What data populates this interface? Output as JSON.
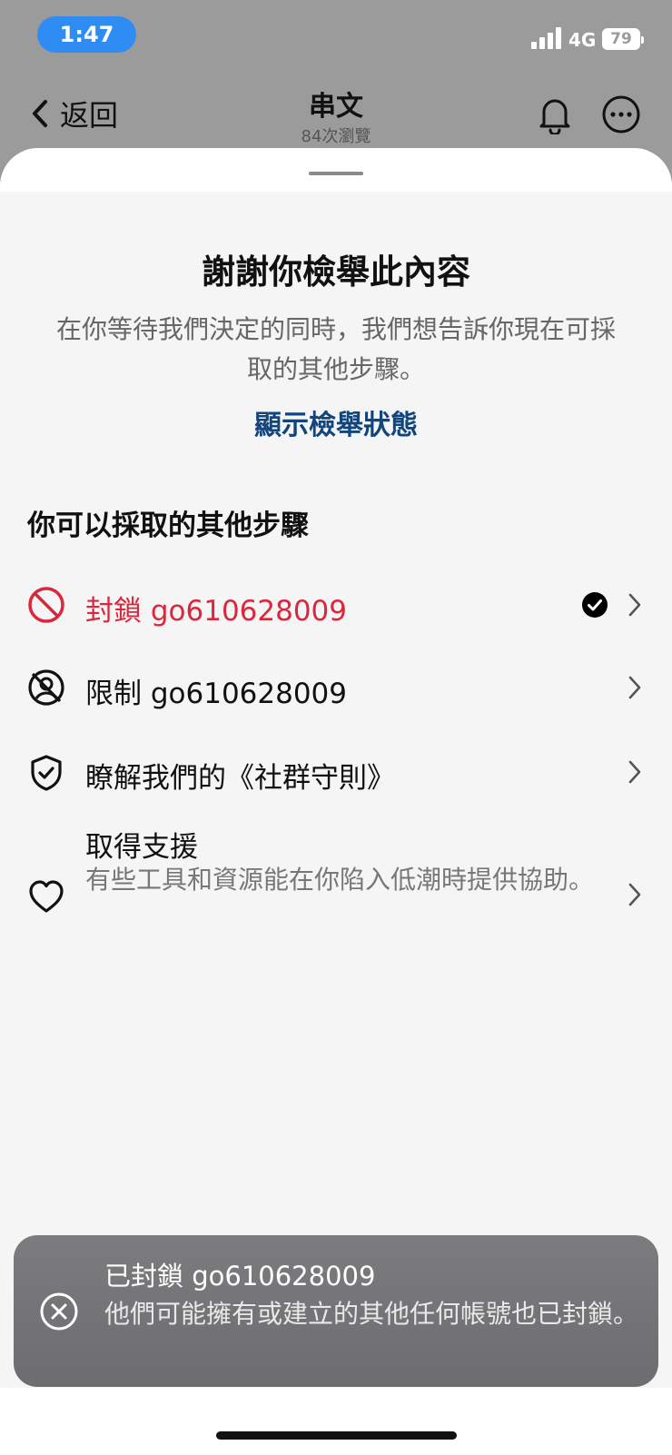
{
  "status_bar": {
    "time": "1:47",
    "network": "4G",
    "battery": "79"
  },
  "nav": {
    "back_label": "返回",
    "title": "串文",
    "subtitle": "84次瀏覽"
  },
  "sheet": {
    "title": "謝謝你檢舉此內容",
    "description": "在你等待我們決定的同時，我們想告訴你現在可採取的其他步驟。",
    "status_link": "顯示檢舉狀態",
    "section_heading": "你可以採取的其他步驟",
    "options": [
      {
        "label": "封鎖 go610628009",
        "icon": "block-icon",
        "checked": true
      },
      {
        "label": "限制 go610628009",
        "icon": "restrict-icon"
      },
      {
        "label": "瞭解我們的《社群守則》",
        "icon": "shield-check-icon"
      },
      {
        "label": "取得支援",
        "sub": "有些工具和資源能在你陷入低潮時提供協助。",
        "icon": "heart-icon"
      }
    ]
  },
  "toast": {
    "title": "已封鎖 go610628009",
    "body": "他們可能擁有或建立的其他任何帳號也已封鎖。",
    "icon": "close-circle-icon"
  },
  "colors": {
    "danger": "#d9283d",
    "link": "#11457e",
    "time_pill": "#2f8cf3"
  }
}
